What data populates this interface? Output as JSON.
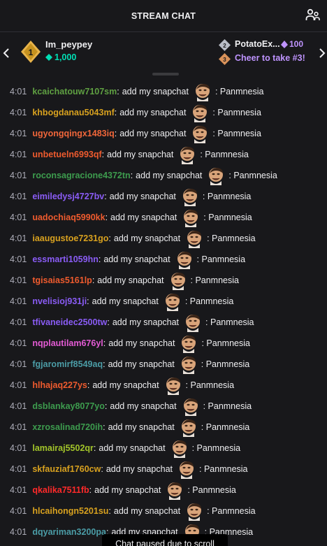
{
  "header": {
    "title": "STREAM CHAT",
    "users_icon": "community-icon"
  },
  "leaderboard": {
    "first": {
      "rank": "1",
      "name": "Im_peypey",
      "amount": "1,000"
    },
    "second": {
      "rank": "2",
      "name": "PotatoEx...",
      "amount": "100"
    },
    "third": {
      "rank": "3",
      "cta": "Cheer to take #3!"
    }
  },
  "colors": {
    "background": "#18181b",
    "timestamp": "#adadb8",
    "teal": "#00e0b5",
    "purple": "#bf94ff"
  },
  "messages": [
    {
      "time": "4:01",
      "user": "kcaichatouw7107sm",
      "color": "#5fa042",
      "text": "add my snapchat",
      "tail": ": Panmnesia"
    },
    {
      "time": "4:01",
      "user": "khbogdanau5043mf",
      "color": "#d8a11f",
      "text": "add my snapchat",
      "tail": ": Panmnesia"
    },
    {
      "time": "4:01",
      "user": "ugyongqingx1483iq",
      "color": "#f0663a",
      "text": "add my snapchat",
      "tail": ": Panmnesia"
    },
    {
      "time": "4:01",
      "user": "unbetueln6993qf",
      "color": "#ef5b2e",
      "text": "add my snapchat",
      "tail": ": Panmnesia"
    },
    {
      "time": "4:01",
      "user": "roconsagracione4372tn",
      "color": "#3d9c4e",
      "text": "add my snapchat",
      "tail": ": Panmnesia"
    },
    {
      "time": "4:01",
      "user": "eimiledysj4727bv",
      "color": "#8a5cf5",
      "text": "add my snapchat",
      "tail": ": Panmnesia"
    },
    {
      "time": "4:01",
      "user": "uadochiaq5990kk",
      "color": "#ef5b2e",
      "text": "add my snapchat",
      "tail": ": Panmnesia"
    },
    {
      "time": "4:01",
      "user": "iaaugustoe7231go",
      "color": "#d8a11f",
      "text": "add my snapchat",
      "tail": ": Panmnesia"
    },
    {
      "time": "4:01",
      "user": "essmarti1059hn",
      "color": "#8a5cf5",
      "text": "add my snapchat",
      "tail": ": Panmnesia"
    },
    {
      "time": "4:01",
      "user": "tgisaias5161lp",
      "color": "#ef5b2e",
      "text": "add my snapchat",
      "tail": ": Panmnesia"
    },
    {
      "time": "4:01",
      "user": "nvelisioj931ji",
      "color": "#8a5cf5",
      "text": "add my snapchat",
      "tail": ": Panmnesia"
    },
    {
      "time": "4:01",
      "user": "tfivaneidec2500tw",
      "color": "#8a5cf5",
      "text": "add my snapchat",
      "tail": ": Panmnesia"
    },
    {
      "time": "4:01",
      "user": "nqplautilam676yl",
      "color": "#e35bd4",
      "text": "add my snapchat",
      "tail": ": Panmnesia"
    },
    {
      "time": "4:01",
      "user": "fgjaromirf8549aq",
      "color": "#4b9ca6",
      "text": "add my snapchat",
      "tail": ": Panmnesia"
    },
    {
      "time": "4:01",
      "user": "hlhajaq227ys",
      "color": "#ef5b2e",
      "text": "add my snapchat",
      "tail": ": Panmnesia"
    },
    {
      "time": "4:01",
      "user": "dsblankay8077yo",
      "color": "#3d9c4e",
      "text": "add my snapchat",
      "tail": ": Panmnesia"
    },
    {
      "time": "4:01",
      "user": "xzrosalinad720ih",
      "color": "#3d9c4e",
      "text": "add my snapchat",
      "tail": ": Panmnesia"
    },
    {
      "time": "4:01",
      "user": "lamairaj5502qr",
      "color": "#a2c42a",
      "text": "add my snapchat",
      "tail": ": Panmnesia"
    },
    {
      "time": "4:01",
      "user": "skfauziaf1760cw",
      "color": "#d8a11f",
      "text": "add my snapchat",
      "tail": ": Panmnesia"
    },
    {
      "time": "4:01",
      "user": "qkalika7511fb",
      "color": "#ff2a2a",
      "text": "add my snapchat",
      "tail": ": Panmnesia"
    },
    {
      "time": "4:01",
      "user": "hlcaihongn5201su",
      "color": "#d8a11f",
      "text": "add my snapchat",
      "tail": ": Panmnesia"
    },
    {
      "time": "4:01",
      "user": "dqyariman3200pa",
      "color": "#4b9ca6",
      "text": "add my snapchat",
      "tail": ": Panmnesia"
    }
  ],
  "paused_text": "Chat paused due to scroll"
}
